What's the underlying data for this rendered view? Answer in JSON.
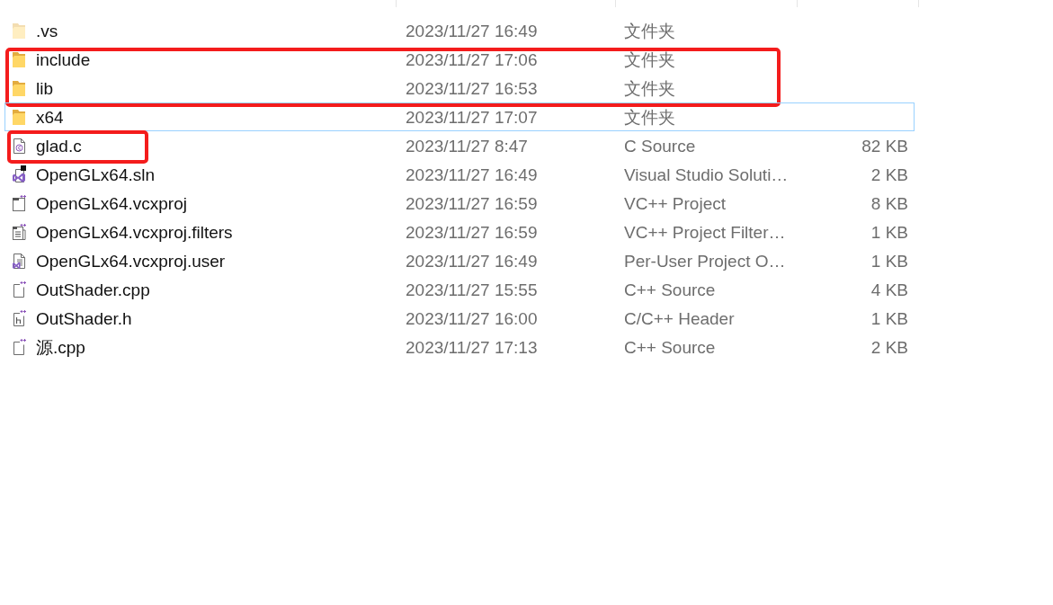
{
  "file_list": {
    "rows": [
      {
        "kind": "folder",
        "name": ".vs",
        "modified": "2023/11/27 16:49",
        "type": "文件夹",
        "hidden": true,
        "focused": false,
        "row_marked": false,
        "name_marked": false
      },
      {
        "kind": "folder",
        "name": "include",
        "modified": "2023/11/27 17:06",
        "type": "文件夹",
        "hidden": false,
        "focused": false,
        "row_marked": true,
        "name_marked": false
      },
      {
        "kind": "folder",
        "name": "lib",
        "modified": "2023/11/27 16:53",
        "type": "文件夹",
        "hidden": false,
        "focused": false,
        "row_marked": true,
        "name_marked": false
      },
      {
        "kind": "folder",
        "name": "x64",
        "modified": "2023/11/27 17:07",
        "type": "文件夹",
        "hidden": false,
        "focused": true,
        "row_marked": false,
        "name_marked": false
      },
      {
        "kind": "c",
        "name": "glad.c",
        "modified": "2023/11/27 8:47",
        "type": "C Source",
        "size": "82 KB",
        "hidden": false,
        "focused": false,
        "row_marked": false,
        "name_marked": true
      },
      {
        "kind": "sln",
        "name": "OpenGLx64.sln",
        "modified": "2023/11/27 16:49",
        "type": "Visual Studio Soluti…",
        "size": "2 KB",
        "hidden": false,
        "focused": false,
        "row_marked": false,
        "name_marked": false
      },
      {
        "kind": "vcxproj",
        "name": "OpenGLx64.vcxproj",
        "modified": "2023/11/27 16:59",
        "type": "VC++ Project",
        "size": "8 KB",
        "hidden": false,
        "focused": false,
        "row_marked": false,
        "name_marked": false
      },
      {
        "kind": "filters",
        "name": "OpenGLx64.vcxproj.filters",
        "modified": "2023/11/27 16:59",
        "type": "VC++ Project Filter…",
        "size": "1 KB",
        "hidden": false,
        "focused": false,
        "row_marked": false,
        "name_marked": false
      },
      {
        "kind": "user",
        "name": "OpenGLx64.vcxproj.user",
        "modified": "2023/11/27 16:49",
        "type": "Per-User Project O…",
        "size": "1 KB",
        "hidden": false,
        "focused": false,
        "row_marked": false,
        "name_marked": false
      },
      {
        "kind": "cpp",
        "name": "OutShader.cpp",
        "modified": "2023/11/27 15:55",
        "type": "C++ Source",
        "size": "4 KB",
        "hidden": false,
        "focused": false,
        "row_marked": false,
        "name_marked": false
      },
      {
        "kind": "h",
        "name": "OutShader.h",
        "modified": "2023/11/27 16:00",
        "type": "C/C++ Header",
        "size": "1 KB",
        "hidden": false,
        "focused": false,
        "row_marked": false,
        "name_marked": false
      },
      {
        "kind": "cpp",
        "name": "源.cpp",
        "modified": "2023/11/27 17:13",
        "type": "C++ Source",
        "size": "2 KB",
        "hidden": false,
        "focused": false,
        "row_marked": false,
        "name_marked": false
      }
    ]
  }
}
